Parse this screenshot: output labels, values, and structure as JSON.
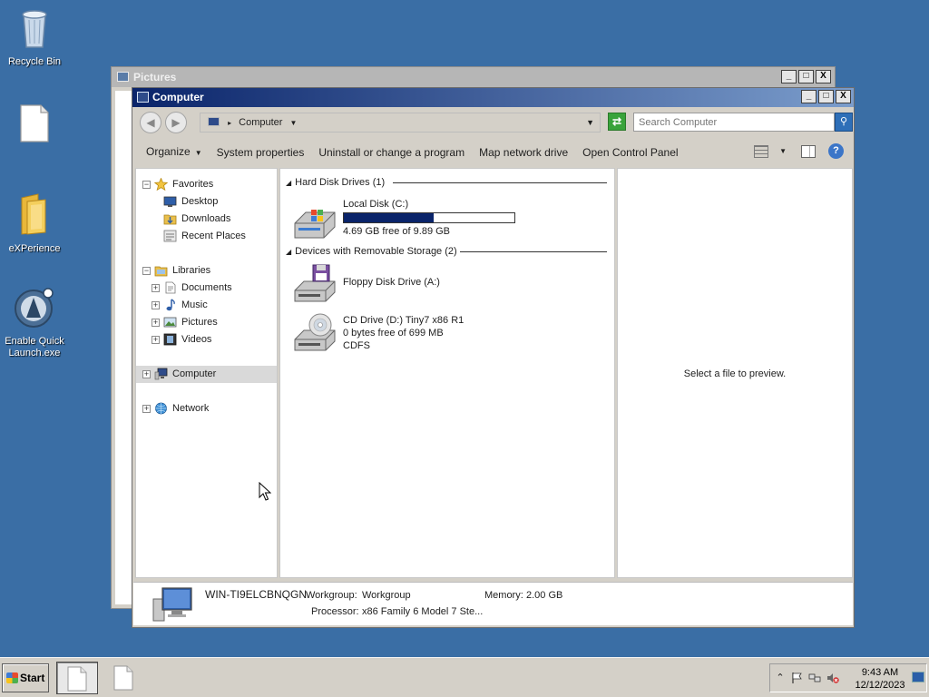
{
  "desktop": {
    "icons": [
      {
        "label": "Recycle Bin",
        "icon": "recycle-bin-icon"
      },
      {
        "label": "",
        "icon": "blank-document-icon"
      },
      {
        "label": "eXPerience",
        "icon": "folder-icon"
      },
      {
        "label": "Enable Quick Launch.exe",
        "icon": "quick-launch-app-icon"
      }
    ]
  },
  "back_window": {
    "title": "Pictures",
    "controls": [
      "_",
      "□",
      "X"
    ]
  },
  "window": {
    "title": "Computer",
    "controls": {
      "minimize": "_",
      "maximize": "□",
      "close": "X"
    },
    "address": {
      "location": "Computer",
      "separator": "▸"
    },
    "search": {
      "placeholder": "Search Computer"
    },
    "toolbar": {
      "organize": "Organize",
      "system_properties": "System properties",
      "uninstall": "Uninstall or change a program",
      "map_drive": "Map network drive",
      "control_panel": "Open Control Panel"
    },
    "nav_pane": {
      "favorites": "Favorites",
      "desktop": "Desktop",
      "downloads": "Downloads",
      "recent_places": "Recent Places",
      "libraries": "Libraries",
      "documents": "Documents",
      "music": "Music",
      "pictures": "Pictures",
      "videos": "Videos",
      "computer": "Computer",
      "network": "Network"
    },
    "content": {
      "group_hdd": "Hard Disk Drives (1)",
      "group_removable": "Devices with Removable Storage (2)",
      "local_disk": {
        "name": "Local Disk (C:)",
        "free_text": "4.69 GB free of 9.89 GB",
        "used_fraction": 0.526
      },
      "floppy": {
        "name": "Floppy Disk Drive (A:)"
      },
      "cd": {
        "name": "CD Drive (D:) Tiny7 x86 R1",
        "free_text": "0 bytes free of 699 MB",
        "fs": "CDFS"
      }
    },
    "preview": {
      "text": "Select a file to preview."
    },
    "details": {
      "computer_name": "WIN-TI9ELCBNQGN",
      "workgroup_label": "Workgroup:",
      "workgroup_value": "Workgroup",
      "memory_label": "Memory:",
      "memory_value": "2.00 GB",
      "processor_label": "Processor:",
      "processor_value": "x86 Family 6 Model 7 Ste..."
    }
  },
  "taskbar": {
    "start_label": "Start",
    "clock_time": "9:43 AM",
    "clock_date": "12/12/2023",
    "tray_icons": [
      "chevron-up-icon",
      "flag-icon",
      "network-icon",
      "volume-muted-icon"
    ]
  },
  "colors": {
    "desktop": "#3a6ea5",
    "titlebar_start": "#0a246a",
    "titlebar_end": "#7b9dcc",
    "disk_bar": "#0a246a"
  }
}
